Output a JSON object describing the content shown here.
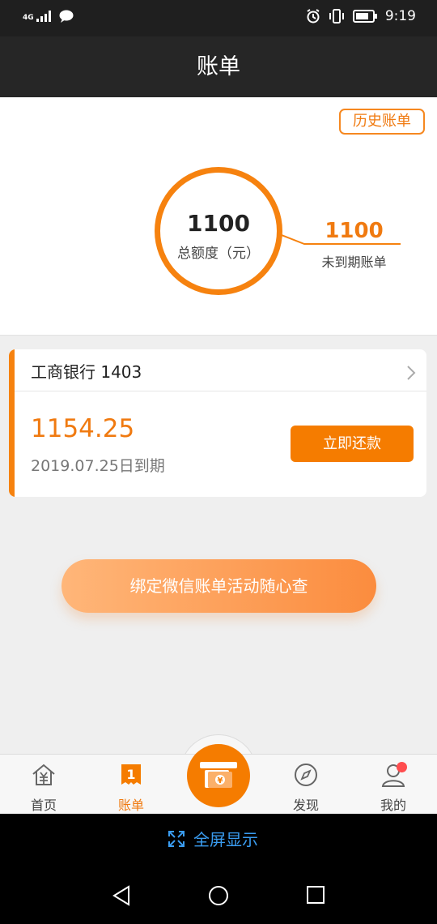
{
  "status_bar": {
    "signal_text": "4G",
    "time": "9:19"
  },
  "header": {
    "title": "账单"
  },
  "summary": {
    "history_button": "历史账单",
    "total_value": "1100",
    "total_label": "总额度（元）",
    "due_value": "1100",
    "due_label": "未到期账单"
  },
  "card": {
    "bank_name": "工商银行 1403",
    "amount": "1154.25",
    "due_date": "2019.07.25日到期",
    "repay_button": "立即还款"
  },
  "bind_button": "绑定微信账单活动随心查",
  "tabbar": {
    "items": [
      {
        "label": "首页",
        "icon": "home-yen-icon"
      },
      {
        "label": "账单",
        "icon": "bill-icon"
      },
      {
        "label": "",
        "icon": "cash-payment-icon"
      },
      {
        "label": "发现",
        "icon": "compass-icon"
      },
      {
        "label": "我的",
        "icon": "user-icon"
      }
    ],
    "active_index": 1
  },
  "fullscreen": {
    "label": "全屏显示",
    "icon": "expand-icon"
  },
  "colors": {
    "accent": "#f57c00",
    "link": "#3a9cf0",
    "header_bg": "#262626"
  }
}
